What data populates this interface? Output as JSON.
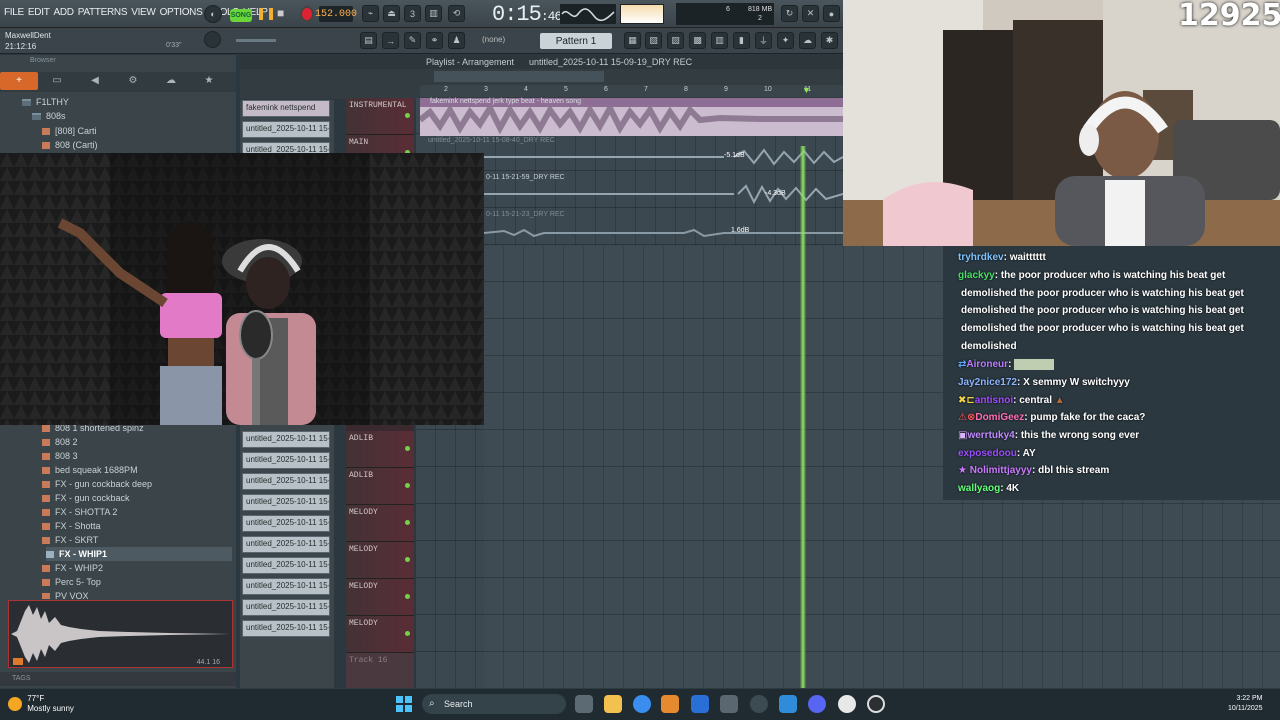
{
  "menu": [
    "FILE",
    "EDIT",
    "ADD",
    "PATTERNS",
    "VIEW",
    "OPTIONS",
    "TOOLS",
    "HELP"
  ],
  "transport": {
    "song_label": "SONG",
    "tempo": "152.000",
    "time": "0:15",
    "time_sub": "46"
  },
  "cpu": {
    "value": "6",
    "memory": "818 MB",
    "poly": "2"
  },
  "header": {
    "user": "MaxwellDent",
    "clock": "21:12:16",
    "hint": "0'33\"",
    "pattern_none": "(none)",
    "pattern": "Pattern 1"
  },
  "browser": {
    "title": "Browser",
    "root": "F1LTHY",
    "folder": "808s",
    "items_top": [
      "[808] Carti",
      "808 (Carti)"
    ],
    "items_bottom": [
      "808 1 shortened spinz",
      "808 2",
      "808 3",
      "bed squeak 1688PM",
      "FX - gun cockback deep",
      "FX - gun cockback",
      "FX - SHOTTA 2",
      "FX - Shotta",
      "FX - SKRT",
      "FX - WHIP1",
      "FX - WHIP2",
      "Perc 5- Top",
      "PV VOX"
    ],
    "selected": "FX - WHIP1",
    "preview_info": "44.1 16",
    "tags_label": "TAGS"
  },
  "playlist": {
    "title": "Playlist - Arrangement",
    "file": "untitled_2025-10-11 15-09-19_DRY REC",
    "bar_numbers": [
      "2",
      "3",
      "4",
      "5",
      "6",
      "7",
      "8",
      "9",
      "10",
      "11"
    ],
    "clip1": "fakemink  nettspend  jerk type beat - heaven song",
    "clip2": "untitled_2025-10-11 15-08-40_DRY REC",
    "clip3": "0-11 15-21-59_DRY REC",
    "clip4": "0-11 15-21-23_DRY REC",
    "db": [
      "-5.1dB",
      "-4.3dB",
      "1.6dB"
    ]
  },
  "channels": [
    "fakemink  nettspend",
    "untitled_2025-10-11 15-",
    "untitled_2025-10-11 15-",
    "untitled_2025-10-11 15-",
    "untitled_2025-10-11 15-",
    "untitled_2025-10-11 15-",
    "untitled_2025-10-11 15-",
    "untitled_2025-10-11 15-",
    "untitled_2025-10-11 15-",
    "untitled_2025-10-11 15-",
    "untitled_2025-10-11 15-",
    "untitled_2025-10-11 15-",
    "untitled_2025-10-11 15-"
  ],
  "tracks": [
    "INSTRUMENTAL",
    "MAIN",
    "ADLIB",
    "ADLIB",
    "MELODY",
    "MELODY",
    "MELODY",
    "MELODY",
    "Track 16"
  ],
  "stream": {
    "viewers": "12925"
  },
  "chat": [
    {
      "user": "tryhrdkev",
      "color": "#7fc4ff",
      "text": "waitttttt"
    },
    {
      "user": "glackyy",
      "color": "#49e06a",
      "text": "the poor producer who is watching his beat get"
    },
    {
      "user": "",
      "color": "#fff",
      "text": "demolished the poor producer who is watching his beat get"
    },
    {
      "user": "",
      "color": "#fff",
      "text": "demolished the poor producer who is watching his beat get"
    },
    {
      "user": "",
      "color": "#fff",
      "text": "demolished the poor producer who is watching his beat get"
    },
    {
      "user": "",
      "color": "#fff",
      "text": "demolished"
    },
    {
      "user": "Aironeur",
      "color": "#b97cff",
      "text": ""
    },
    {
      "user": "Jay2nice172",
      "color": "#8cb4ff",
      "text": "X semmy W switchyyy"
    },
    {
      "user": "antisnoi",
      "color": "#a24cff",
      "text": "central"
    },
    {
      "user": "DomiGeez",
      "color": "#ff6fb5",
      "text": "pump fake for the caca?"
    },
    {
      "user": "werrtuky4",
      "color": "#c08bff",
      "text": "this the wrong song ever"
    },
    {
      "user": "exposedoou",
      "color": "#9a4dff",
      "text": "AY"
    },
    {
      "user": "Nolimittjayyy",
      "color": "#c97bff",
      "text": "dbl this stream"
    },
    {
      "user": "wallyaog",
      "color": "#64ff7a",
      "text": "4K"
    }
  ],
  "taskbar": {
    "temp": "77°F",
    "weather": "Mostly sunny",
    "search": "Search",
    "time": "3:22 PM",
    "date": "10/11/2025"
  }
}
